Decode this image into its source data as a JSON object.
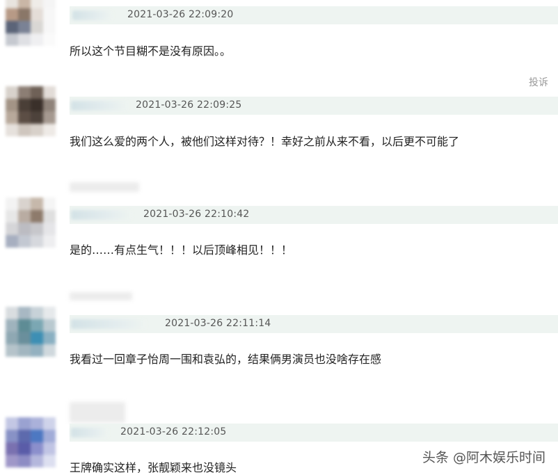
{
  "comments": [
    {
      "timestamp": "2021-03-26 22:09:20",
      "text": "所以这个节目糊不是没有原因。。"
    },
    {
      "timestamp": "2021-03-26 22:09:25",
      "text": "我们这么爱的两个人，被他们这样对待？！幸好之前从来不看，以后更不可能了"
    },
    {
      "timestamp": "2021-03-26 22:10:42",
      "text": "是的……有点生气！！！以后顶峰相见！！！"
    },
    {
      "timestamp": "2021-03-26 22:11:14",
      "text": "我看过一回章子怡周一围和袁弘的，结果俩男演员也没啥存在感"
    },
    {
      "timestamp": "2021-03-26 22:12:05",
      "text": "王牌确实这样，张靓颖来也没镜头"
    }
  ],
  "report_label": "投诉",
  "watermark": "头条 @阿木娱乐时间"
}
